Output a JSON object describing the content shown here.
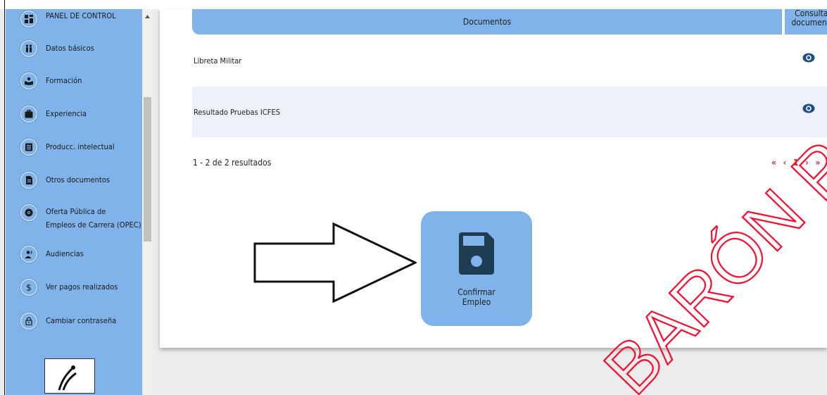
{
  "sidebar": {
    "items": [
      {
        "label": "PANEL DE CONTROL",
        "icon": "dashboard-icon"
      },
      {
        "label": "Datos básicos",
        "icon": "people-icon"
      },
      {
        "label": "Formación",
        "icon": "education-icon"
      },
      {
        "label": "Experiencia",
        "icon": "briefcase-icon"
      },
      {
        "label": "Producc. intelectual",
        "icon": "book-icon"
      },
      {
        "label": "Otros documentos",
        "icon": "document-icon"
      },
      {
        "label": "Oferta Pública de",
        "label2": "Empleos de Carrera (OPEC)",
        "icon": "globe-icon"
      },
      {
        "label": "Audiencias",
        "icon": "audience-icon"
      },
      {
        "label": "Ver pagos realizados",
        "icon": "dollar-icon"
      },
      {
        "label": "Cambiar contraseña",
        "icon": "lock-icon"
      }
    ]
  },
  "table": {
    "headers": {
      "documents": "Documentos",
      "consult_line1": "Consultar",
      "consult_line2": "documento"
    },
    "rows": [
      {
        "name": "Libreta Militar"
      },
      {
        "name": "Resultado Pruebas ICFES"
      }
    ],
    "results_text": "1 - 2 de 2 resultados"
  },
  "pagination": {
    "first": "«",
    "prev": "‹",
    "current": "1",
    "next": "›",
    "last": "»"
  },
  "confirm": {
    "line1": "Confirmar",
    "line2": "Empleo"
  },
  "watermark": {
    "text": "BARÓN POR",
    "color": "#ff0a2e"
  },
  "colors": {
    "accent": "#7fb3ea",
    "eye_icon": "#1f4f8a",
    "pager": "#c62828"
  }
}
